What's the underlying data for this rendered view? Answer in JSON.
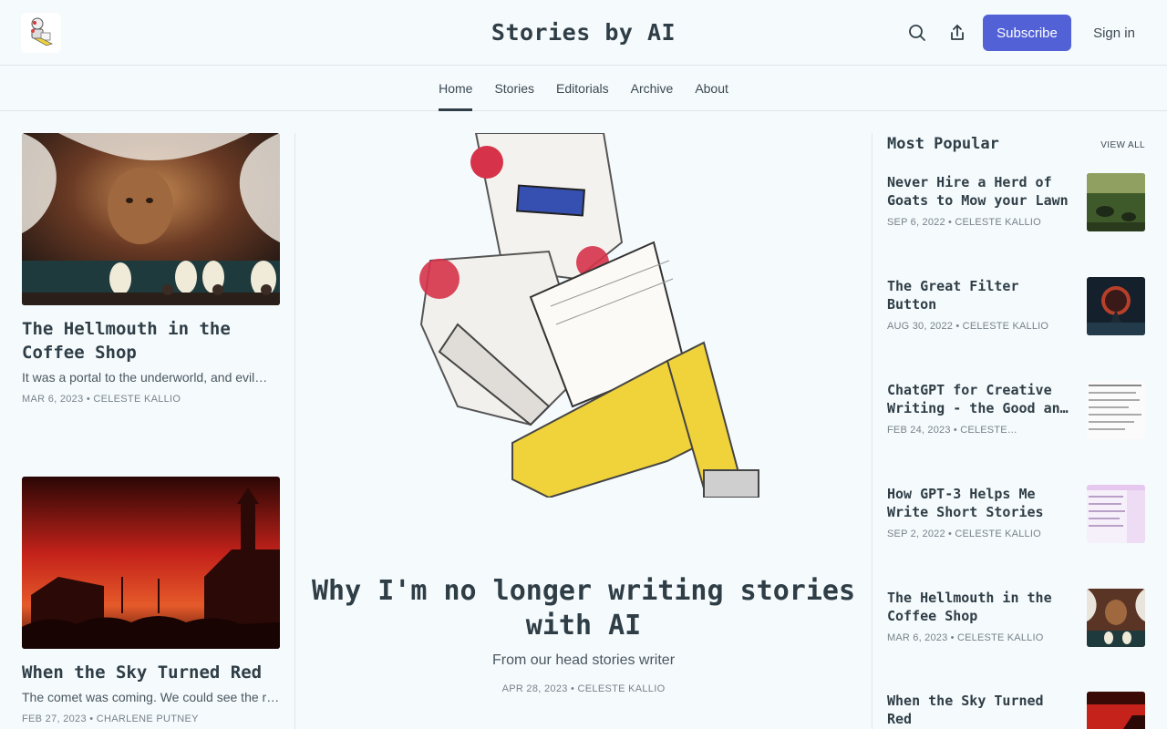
{
  "header": {
    "site_title": "Stories by AI",
    "subscribe_label": "Subscribe",
    "signin_label": "Sign in",
    "accent_color": "#5262d6"
  },
  "nav": {
    "items": [
      {
        "label": "Home",
        "active": true
      },
      {
        "label": "Stories"
      },
      {
        "label": "Editorials"
      },
      {
        "label": "Archive"
      },
      {
        "label": "About"
      }
    ]
  },
  "left_posts": [
    {
      "title": "The Hellmouth in the Coffee Shop",
      "subtitle": "It was a portal to the underworld, and evil…",
      "meta": "MAR 6, 2023 • CELESTE KALLIO"
    },
    {
      "title": "When the Sky Turned Red",
      "subtitle": "The comet was coming. We could see the r…",
      "meta": "FEB 27, 2023 • CHARLENE PUTNEY"
    }
  ],
  "hero": {
    "title": "Why I'm no longer writing stories with AI",
    "subtitle": "From our head stories writer",
    "meta": "APR 28, 2023 • CELESTE KALLIO"
  },
  "popular": {
    "heading": "Most Popular",
    "view_all": "VIEW ALL",
    "items": [
      {
        "title": "Never Hire a Herd of Goats to Mow your Lawn",
        "meta": "SEP 6, 2022 • CELESTE KALLIO"
      },
      {
        "title": "The Great Filter Button",
        "meta": "AUG 30, 2022 • CELESTE KALLIO"
      },
      {
        "title": "ChatGPT for Creative Writing - the Good an…",
        "meta": "FEB 24, 2023 • CELESTE…"
      },
      {
        "title": "How GPT-3 Helps Me Write Short Stories",
        "meta": "SEP 2, 2022 • CELESTE KALLIO"
      },
      {
        "title": "The Hellmouth in the Coffee Shop",
        "meta": "MAR 6, 2023 • CELESTE KALLIO"
      },
      {
        "title": "When the Sky Turned Red",
        "meta": ""
      }
    ]
  }
}
